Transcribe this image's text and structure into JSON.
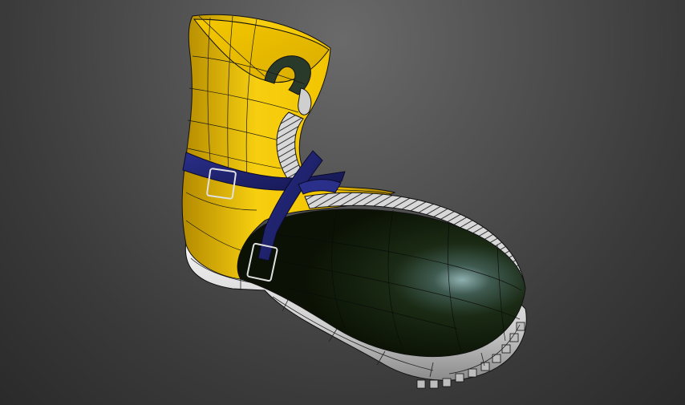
{
  "scene": {
    "subject": "boot-3d-model",
    "background_top": "#6a6a6a",
    "background_bottom": "#2a2a2a",
    "colors": {
      "shaft_yellow": "#f2c400",
      "shaft_yellow_dark": "#b38a00",
      "toe_dark": "#0f1a08",
      "toe_highlight": "#6c8a8a",
      "strap_blue": "#1c1f6e",
      "sole_white": "#e8e8e8",
      "sole_shadow": "#9a9a9a",
      "wire": "#111111"
    }
  }
}
